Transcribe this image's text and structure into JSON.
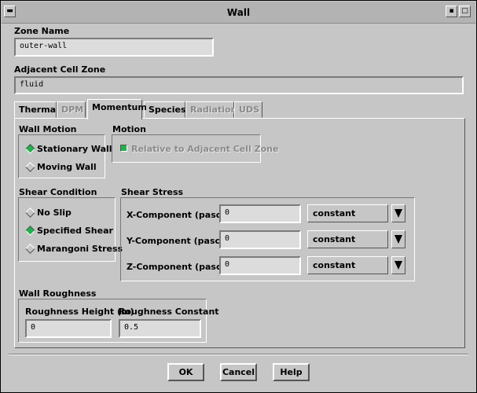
{
  "window": {
    "title": "Wall"
  },
  "zone_name": {
    "label": "Zone Name",
    "value": "outer-wall"
  },
  "adjacent_cell_zone": {
    "label": "Adjacent Cell Zone",
    "value": "fluid"
  },
  "tabs": [
    {
      "label": "Thermal",
      "state": "enabled"
    },
    {
      "label": "DPM",
      "state": "disabled"
    },
    {
      "label": "Momentum",
      "state": "active"
    },
    {
      "label": "Species",
      "state": "enabled"
    },
    {
      "label": "Radiation",
      "state": "disabled"
    },
    {
      "label": "UDS",
      "state": "disabled"
    }
  ],
  "wall_motion": {
    "label": "Wall Motion",
    "options": [
      {
        "label": "Stationary Wall",
        "selected": true
      },
      {
        "label": "Moving Wall",
        "selected": false
      }
    ]
  },
  "motion": {
    "label": "Motion",
    "relative_label": "Relative to Adjacent Cell Zone",
    "relative_checked": true
  },
  "shear_condition": {
    "label": "Shear Condition",
    "options": [
      {
        "label": "No Slip",
        "selected": false
      },
      {
        "label": "Specified Shear",
        "selected": true
      },
      {
        "label": "Marangoni Stress",
        "selected": false
      }
    ]
  },
  "shear_stress": {
    "label": "Shear Stress",
    "rows": [
      {
        "label": "X-Component (pascal)",
        "value": "0",
        "method": "constant"
      },
      {
        "label": "Y-Component (pascal)",
        "value": "0",
        "method": "constant"
      },
      {
        "label": "Z-Component (pascal)",
        "value": "0",
        "method": "constant"
      }
    ]
  },
  "wall_roughness": {
    "label": "Wall Roughness",
    "height_label": "Roughness Height (m)",
    "height_value": "0",
    "constant_label": "Roughness Constant",
    "constant_value": "0.5"
  },
  "buttons": {
    "ok": "OK",
    "cancel": "Cancel",
    "help": "Help"
  },
  "colors": {
    "background": "#c6c6c6",
    "radio_selected": "#22b14c"
  },
  "icons": {
    "dropdown": "triangle-down-icon",
    "minimize": "minimize-icon",
    "maximize": "maximize-icon"
  }
}
